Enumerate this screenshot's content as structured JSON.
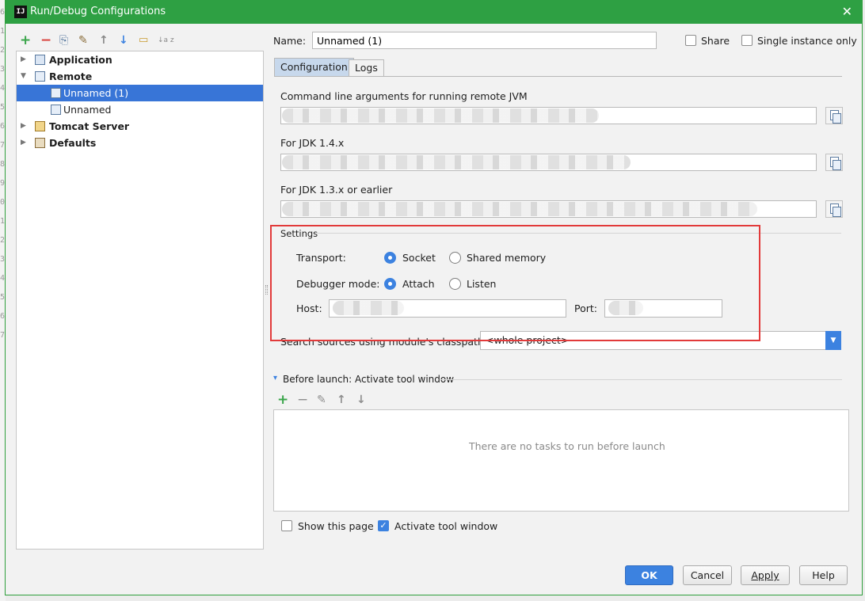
{
  "window": {
    "title": "Run/Debug Configurations",
    "close_glyph": "✕"
  },
  "gutter_numbers": [
    "6",
    "1",
    "2",
    "3",
    "4",
    "5",
    "6",
    "7",
    "8",
    "9",
    "0",
    "1",
    "2",
    "3",
    "4",
    "5",
    "6",
    "7"
  ],
  "toolbar": {
    "add": "+",
    "remove": "−",
    "copy": "⎘",
    "edit": "✎",
    "up": "↑",
    "down": "↓",
    "folder": "▭",
    "sort": "↓a z"
  },
  "tree": {
    "items": [
      {
        "label": "Application",
        "expander": "▶"
      },
      {
        "label": "Remote",
        "expander": "▼"
      },
      {
        "label": "Unnamed (1)"
      },
      {
        "label": "Unnamed"
      },
      {
        "label": "Tomcat Server",
        "expander": "▶"
      },
      {
        "label": "Defaults",
        "expander": "▶"
      }
    ]
  },
  "header": {
    "name_label": "Name:",
    "name_value": "Unnamed (1)",
    "share_label": "Share",
    "single_instance_label": "Single instance only"
  },
  "tabs": [
    {
      "label": "Configuration"
    },
    {
      "label": "Logs"
    }
  ],
  "config": {
    "cmd_label": "Command line arguments for running remote JVM",
    "jdk14_label": "For JDK 1.4.x",
    "jdk13_label": "For JDK 1.3.x or earlier",
    "settings_title": "Settings",
    "transport_label": "Transport:",
    "transport_socket": "Socket",
    "transport_shared": "Shared memory",
    "debugger_label": "Debugger mode:",
    "debugger_attach": "Attach",
    "debugger_listen": "Listen",
    "host_label": "Host:",
    "port_label": "Port:",
    "search_sources_label": "Search sources using module's classpath:",
    "search_sources_value": "<whole project>",
    "dropdown_glyph": "▼"
  },
  "before_launch": {
    "title": "Before launch: Activate tool window",
    "collapse_glyph": "▾",
    "add": "+",
    "remove": "−",
    "edit": "✎",
    "up": "↑",
    "down": "↓",
    "empty_text": "There are no tasks to run before launch",
    "show_page_label": "Show this page",
    "activate_label": "Activate tool window"
  },
  "buttons": {
    "ok": "OK",
    "cancel": "Cancel",
    "apply": "Apply",
    "help": "Help"
  },
  "colors": {
    "titlebar": "#2ea043",
    "selection": "#3875d7",
    "accent": "#3c82e0",
    "highlight_box": "#e23a3a"
  }
}
